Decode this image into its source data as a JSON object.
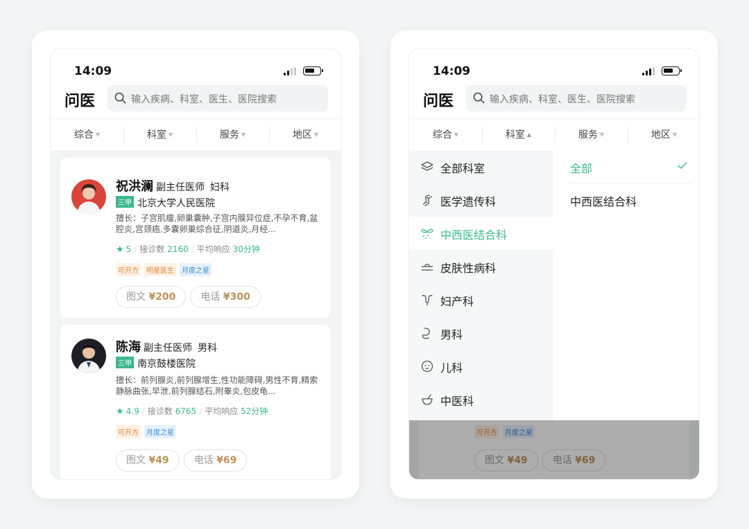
{
  "status_bar": {
    "time": "14:09"
  },
  "header": {
    "logo": "问医",
    "search_placeholder": "输入疾病、科室、医生、医院搜索"
  },
  "filters": [
    {
      "label": "综合"
    },
    {
      "label": "科室"
    },
    {
      "label": "服务"
    },
    {
      "label": "地区"
    }
  ],
  "doctors": [
    {
      "name": "祝洪澜",
      "title": "副主任医师",
      "dept": "妇科",
      "level": "三甲",
      "hospital": "北京大学人民医院",
      "specialty": "擅长：子宫肌瘤,卵巢囊肿,子宫内膜异位症,不孕不育,盆腔炎,宫颈癌,多囊卵巢综合征,阴道炎,月经...",
      "rating": "5",
      "visits_label": "接诊数",
      "visits": "2160",
      "response_label": "平均响应",
      "response": "30分钟",
      "badges": [
        "可开方",
        "明星医生",
        "月度之星"
      ],
      "text_consult_label": "图文",
      "text_consult_price": "¥200",
      "phone_consult_label": "电话",
      "phone_consult_price": "¥300"
    },
    {
      "name": "陈海",
      "title": "副主任医师",
      "dept": "男科",
      "level": "三甲",
      "hospital": "南京鼓楼医院",
      "specialty": "擅长：前列腺炎,前列腺增生,性功能障碍,男性不育,精索静脉曲张,早泄,前列腺结石,附睾炎,包皮龟...",
      "rating": "4.9",
      "visits_label": "接诊数",
      "visits": "6765",
      "response_label": "平均响应",
      "response": "52分钟",
      "badges": [
        "可开方",
        "月度之星"
      ],
      "text_consult_label": "图文",
      "text_consult_price": "¥49",
      "phone_consult_label": "电话",
      "phone_consult_price": "¥69"
    }
  ],
  "departments": [
    {
      "label": "全部科室",
      "icon": "layers-icon"
    },
    {
      "label": "医学遗传科",
      "icon": "dna-icon"
    },
    {
      "label": "中西医结合科",
      "icon": "herb-icon",
      "active": true
    },
    {
      "label": "皮肤性病科",
      "icon": "skin-icon"
    },
    {
      "label": "妇产科",
      "icon": "uterus-icon"
    },
    {
      "label": "男科",
      "icon": "male-icon"
    },
    {
      "label": "儿科",
      "icon": "baby-icon"
    },
    {
      "label": "中医科",
      "icon": "mortar-icon"
    }
  ],
  "sub_departments": [
    {
      "label": "全部",
      "active": true
    },
    {
      "label": "中西医结合科"
    }
  ],
  "colors": {
    "accent": "#3cb88a",
    "price": "#b9925a",
    "badge_orange": "#e8873a",
    "badge_blue": "#3e8ad4"
  }
}
